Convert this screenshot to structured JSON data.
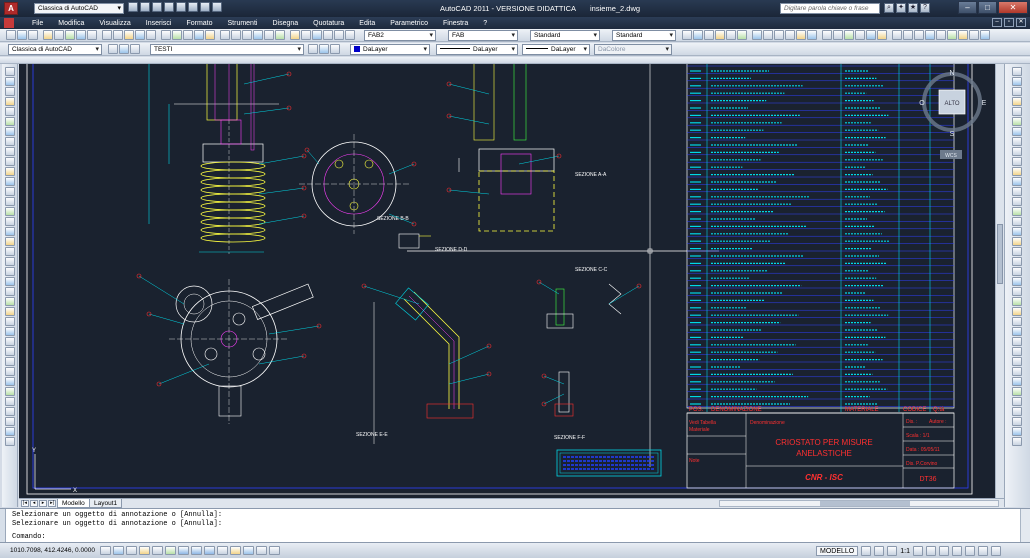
{
  "app": {
    "title": "AutoCAD 2011 - VERSIONE DIDATTICA",
    "document": "insieme_2.dwg",
    "logo": "A",
    "workspace": "Classica di AutoCAD",
    "search_placeholder": "Digitare parola chiave o frase"
  },
  "menu": [
    "File",
    "Modifica",
    "Visualizza",
    "Inserisci",
    "Formato",
    "Strumenti",
    "Disegna",
    "Quotatura",
    "Edita",
    "Parametrico",
    "Finestra",
    "?"
  ],
  "toolbar1": {
    "text_style": "FAB2",
    "dim_style": "FAB",
    "table_style": "Standard",
    "multileader_style": "Standard"
  },
  "toolbar2": {
    "workspace": "Classica di AutoCAD",
    "layer": "TESTI",
    "color": "DaLayer",
    "linetype": "DaLayer",
    "lineweight": "DaLayer",
    "plotstyle": "DaColore"
  },
  "viewcube": {
    "face": "ALTO",
    "north": "N",
    "south": "S",
    "east": "E",
    "west": "O",
    "wcs": "WCS"
  },
  "drawing": {
    "sections": [
      "SEZIONE A-A",
      "SEZIONE B-B",
      "SEZIONE D-D",
      "SEZIONE C-C",
      "SEZIONE E-E",
      "SEZIONE F-F"
    ],
    "parts_header": {
      "pos": "POS.",
      "denominazione": "DENOMINAZIONE",
      "materiale": "MATERIALE",
      "codice": "CODICE",
      "quantita": "Q.tà"
    },
    "title_block": {
      "title_line1": "CRIOSTATO PER MISURE",
      "title_line2": "ANELASTICHE",
      "company": "CNR - ISC",
      "code": "DT36",
      "scala": "Scala : 1/1",
      "data": "Data : 05/05/11",
      "dis": "Dis. :",
      "autore": "Autore :",
      "designer": "Dis. P.Corvino",
      "denominazione": "Denominazione",
      "materiale": "Materiale",
      "note": "Note",
      "vedi": "Vedi Tabella"
    }
  },
  "layout_tabs": [
    "Modello",
    "Layout1"
  ],
  "command_lines": [
    "Selezionare un oggetto di annotazione o [Annulla]:",
    "Selezionare un oggetto di annotazione o [Annulla]:",
    "Comando:"
  ],
  "status": {
    "coords": "1010.7098, 412.4246, 0.0000",
    "space": "MODELLO",
    "scale": "1:1"
  },
  "colors": {
    "canvas": "#1a222f",
    "titlebar": "#1b2638",
    "cyan": "#00d8e6",
    "blue": "#2040ff",
    "red": "#ff3030",
    "yellow": "#ffff40",
    "green": "#40ff40",
    "magenta": "#ff40ff"
  }
}
